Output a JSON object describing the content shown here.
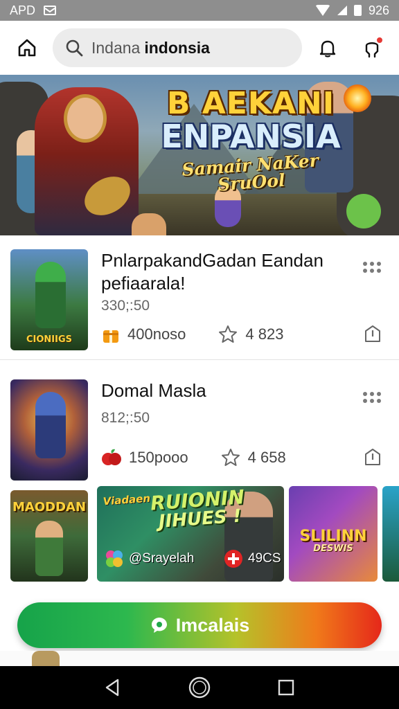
{
  "status_bar": {
    "carrier": "APD",
    "time": "926",
    "icons": [
      "mail-icon",
      "wifi-icon",
      "signal-icon",
      "battery-icon"
    ]
  },
  "header": {
    "search": {
      "placeholder": "Indana",
      "query": "indonsia"
    },
    "icons": [
      "home-icon",
      "search-icon",
      "bell-icon",
      "notification-icon"
    ]
  },
  "banner": {
    "title_line1": "B AEKANI",
    "title_line2": "ENPANSIA",
    "title_line3": "Samair NaKer SruOol",
    "slides": 3,
    "active_slide": 1
  },
  "list": [
    {
      "title": "PnlarpakandGadan Eandan pefiaarala!",
      "subtitle": "330;:50",
      "thumb_caption": "CIONIIGS",
      "downloads": "400noso",
      "rating": "4 823"
    },
    {
      "title": "Domal Masla",
      "subtitle": "812;:50",
      "downloads": "150pooo",
      "rating": "4 658"
    }
  ],
  "carousel": {
    "card1_title": "MAODDAN",
    "card2": {
      "line1": "Viadaen",
      "line2": "RUIONIN",
      "line3": "JIHUES !",
      "user": "@Srayelah",
      "score": "49CS"
    },
    "card3": {
      "line1": "SLILINN",
      "line2": "DESWIS"
    }
  },
  "cta": {
    "label": "Imcalais"
  },
  "colors": {
    "accent_green": "#16a34a",
    "accent_red": "#e5281a",
    "badge_red": "#e53935"
  }
}
